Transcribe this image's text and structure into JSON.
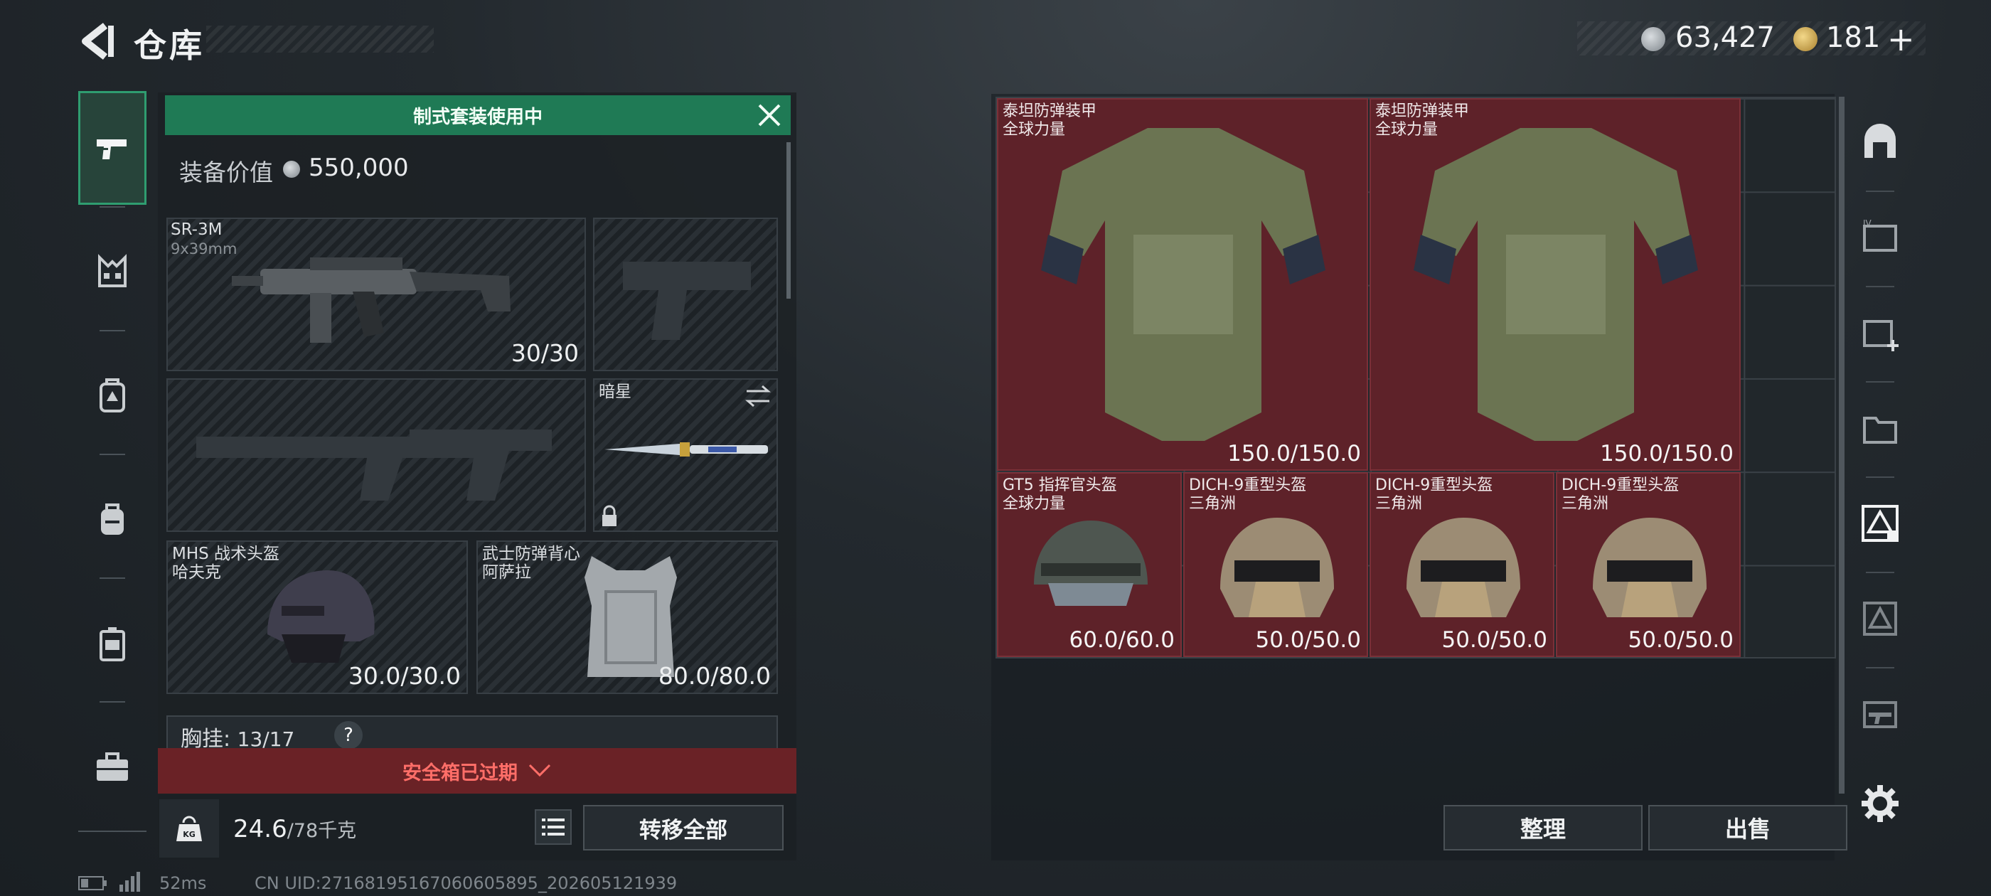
{
  "header": {
    "title": "仓库",
    "currency": [
      {
        "icon": "silver-coin-icon",
        "value": "63,427"
      },
      {
        "icon": "gold-coin-icon",
        "value": "181"
      }
    ],
    "add_label": "+"
  },
  "left_tabs": [
    "pistol-tab",
    "vest-tab",
    "backpack-armor-tab",
    "backpack-tab",
    "case-tab",
    "toolbox-tab"
  ],
  "loadout": {
    "banner": "制式套装使用中",
    "value_label": "装备价值",
    "value": "550,000",
    "primary": {
      "name": "SR-3M",
      "caliber": "9x39mm",
      "ammo": "30/30"
    },
    "melee": {
      "name": "暗星"
    },
    "helmet": {
      "name": "MHS 战术头盔",
      "sub": "哈夫克",
      "durability": "30.0/30.0"
    },
    "armor": {
      "name": "武士防弹背心",
      "sub": "阿萨拉",
      "durability": "80.0/80.0"
    },
    "rig_label": "胸挂:",
    "rig_value": "13/17",
    "rig_help": "?",
    "safebox": "安全箱已过期",
    "weight": "24.6",
    "weight_max": "/78千克",
    "weight_icon_label": "KG",
    "transfer_all": "转移全部"
  },
  "footer": {
    "ping": "52ms",
    "uid": "CN UID:2716819516706060589​5_202605121939"
  },
  "storage": {
    "items": [
      {
        "name": "泰坦防弹装甲",
        "sub": "全球力量",
        "durability": "150.0/150.0"
      },
      {
        "name": "泰坦防弹装甲",
        "sub": "全球力量",
        "durability": "150.0/150.0"
      },
      {
        "name": "GT5 指挥官头盔",
        "sub": "全球力量",
        "durability": "60.0/60.0"
      },
      {
        "name": "DICH-9重型头盔",
        "sub": "三角洲",
        "durability": "50.0/50.0"
      },
      {
        "name": "DICH-9重型头盔",
        "sub": "三角洲",
        "durability": "50.0/50.0"
      },
      {
        "name": "DICH-9重型头盔",
        "sub": "三角洲",
        "durability": "50.0/50.0"
      }
    ],
    "sort": "整理",
    "sell": "出售"
  },
  "right_tabs": [
    "home-tab",
    "storage-1-tab",
    "storage-2-tab",
    "storage-3-tab",
    "storage-4-tab",
    "storage-5-tab",
    "storage-6-tab",
    "settings-tab"
  ]
}
